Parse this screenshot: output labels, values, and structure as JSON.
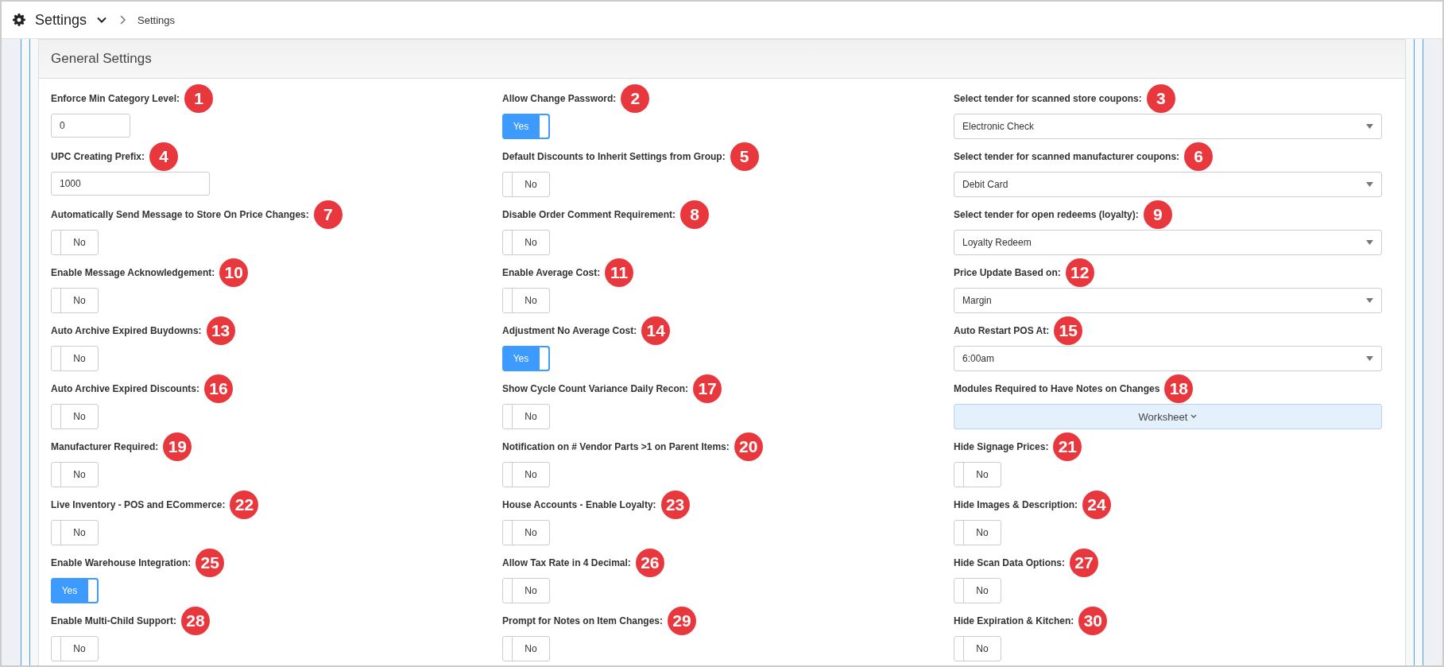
{
  "header": {
    "title": "Settings",
    "breadcrumb": "Settings"
  },
  "panel": {
    "title": "General Settings"
  },
  "columns": [
    [
      {
        "kind": "input",
        "label": "Enforce Min Category Level:",
        "badge": "1",
        "value": "0"
      },
      {
        "kind": "input-wide",
        "label": "UPC Creating Prefix:",
        "badge": "4",
        "value": "1000"
      },
      {
        "kind": "toggle",
        "label": "Automatically Send Message to Store On Price Changes:",
        "badge": "7",
        "on": false,
        "text": "No"
      },
      {
        "kind": "toggle",
        "label": "Enable Message Acknowledgement:",
        "badge": "10",
        "on": false,
        "text": "No"
      },
      {
        "kind": "toggle",
        "label": "Auto Archive Expired Buydowns:",
        "badge": "13",
        "on": false,
        "text": "No"
      },
      {
        "kind": "toggle",
        "label": "Auto Archive Expired Discounts:",
        "badge": "16",
        "on": false,
        "text": "No"
      },
      {
        "kind": "toggle",
        "label": "Manufacturer Required:",
        "badge": "19",
        "on": false,
        "text": "No"
      },
      {
        "kind": "toggle",
        "label": "Live Inventory - POS and ECommerce:",
        "badge": "22",
        "on": false,
        "text": "No"
      },
      {
        "kind": "toggle",
        "label": "Enable Warehouse Integration:",
        "badge": "25",
        "on": true,
        "text": "Yes"
      },
      {
        "kind": "toggle",
        "label": "Enable Multi-Child Support:",
        "badge": "28",
        "on": false,
        "text": "No"
      }
    ],
    [
      {
        "kind": "toggle",
        "label": "Allow Change Password:",
        "badge": "2",
        "on": true,
        "text": "Yes"
      },
      {
        "kind": "toggle",
        "label": "Default Discounts to Inherit Settings from Group:",
        "badge": "5",
        "on": false,
        "text": "No"
      },
      {
        "kind": "toggle",
        "label": "Disable Order Comment Requirement:",
        "badge": "8",
        "on": false,
        "text": "No"
      },
      {
        "kind": "toggle",
        "label": "Enable Average Cost:",
        "badge": "11",
        "on": false,
        "text": "No"
      },
      {
        "kind": "toggle",
        "label": "Adjustment No Average Cost:",
        "badge": "14",
        "on": true,
        "text": "Yes"
      },
      {
        "kind": "toggle",
        "label": "Show Cycle Count Variance Daily Recon:",
        "badge": "17",
        "on": false,
        "text": "No"
      },
      {
        "kind": "toggle",
        "label": "Notification on # Vendor Parts >1 on Parent Items:",
        "badge": "20",
        "on": false,
        "text": "No"
      },
      {
        "kind": "toggle",
        "label": "House Accounts - Enable Loyalty:",
        "badge": "23",
        "on": false,
        "text": "No"
      },
      {
        "kind": "toggle",
        "label": "Allow Tax Rate in 4 Decimal:",
        "badge": "26",
        "on": false,
        "text": "No"
      },
      {
        "kind": "toggle",
        "label": "Prompt for Notes on Item Changes:",
        "badge": "29",
        "on": false,
        "text": "No"
      }
    ],
    [
      {
        "kind": "select",
        "label": "Select tender for scanned store coupons:",
        "badge": "3",
        "value": "Electronic Check"
      },
      {
        "kind": "select",
        "label": "Select tender for scanned manufacturer coupons:",
        "badge": "6",
        "value": "Debit Card"
      },
      {
        "kind": "select",
        "label": "Select tender for open redeems (loyalty):",
        "badge": "9",
        "value": "Loyalty Redeem"
      },
      {
        "kind": "select",
        "label": "Price Update Based on:",
        "badge": "12",
        "value": "Margin"
      },
      {
        "kind": "select",
        "label": "Auto Restart POS At:",
        "badge": "15",
        "value": "6:00am"
      },
      {
        "kind": "multiselect",
        "label": "Modules Required to Have Notes on Changes",
        "badge": "18",
        "value": "Worksheet"
      },
      {
        "kind": "toggle",
        "label": "Hide Signage Prices:",
        "badge": "21",
        "on": false,
        "text": "No"
      },
      {
        "kind": "toggle",
        "label": "Hide Images & Description:",
        "badge": "24",
        "on": false,
        "text": "No"
      },
      {
        "kind": "toggle",
        "label": "Hide Scan Data Options:",
        "badge": "27",
        "on": false,
        "text": "No"
      },
      {
        "kind": "toggle",
        "label": "Hide Expiration & Kitchen:",
        "badge": "30",
        "on": false,
        "text": "No"
      }
    ]
  ]
}
